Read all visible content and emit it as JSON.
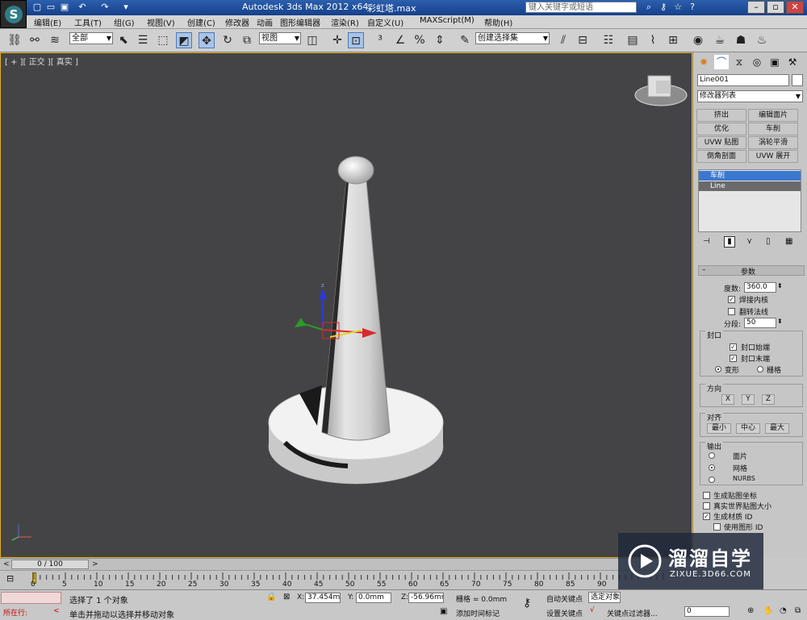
{
  "app": {
    "title": "Autodesk 3ds Max  2012 x64",
    "file_name": "彩虹塔.max",
    "search_placeholder": "键入关键字或短语"
  },
  "menu": [
    "编辑(E)",
    "工具(T)",
    "组(G)",
    "视图(V)",
    "创建(C)",
    "修改器",
    "动画",
    "图形编辑器",
    "渲染(R)",
    "自定义(U)",
    "MAXScript(M)",
    "帮助(H)"
  ],
  "toolbar": {
    "selection_filter": "全部",
    "reference_coord": "视图",
    "named_selection": "创建选择集"
  },
  "viewport": {
    "label": "[ + ][ 正交 ][ 真实 ]"
  },
  "command_panel": {
    "object_name": "Line001",
    "modifier_list": "修改器列表",
    "modifier_buttons": [
      "挤出",
      "编辑面片",
      "优化",
      "车削",
      "UVW 贴图",
      "涡轮平滑",
      "倒角剖面",
      "UVW 展开"
    ],
    "stack": [
      "车削",
      "Line"
    ],
    "params_title": "参数",
    "degrees_label": "度数:",
    "degrees_value": "360.0",
    "weld_core": "焊接内核",
    "flip_normals": "翻转法线",
    "segments_label": "分段:",
    "segments_value": "50",
    "capping_title": "封口",
    "cap_start": "封口始端",
    "cap_end": "封口末端",
    "morph": "变形",
    "grid": "栅格",
    "direction_title": "方向",
    "dir_x": "X",
    "dir_y": "Y",
    "dir_z": "Z",
    "align_title": "对齐",
    "align_min": "最小",
    "align_center": "中心",
    "align_max": "最大",
    "output_title": "输出",
    "out_patch": "面片",
    "out_mesh": "网格",
    "out_nurbs": "NURBS",
    "gen_map_coords": "生成贴图坐标",
    "real_world_map": "真实世界贴图大小",
    "gen_mat_ids": "生成材质 ID",
    "use_shape_ids": "使用图形 ID"
  },
  "timeline": {
    "frame": "0 / 100",
    "ticks": [
      "0",
      "5",
      "10",
      "15",
      "20",
      "25",
      "30",
      "35",
      "40",
      "45",
      "50",
      "55",
      "60",
      "65",
      "70",
      "75",
      "80",
      "85",
      "90"
    ]
  },
  "status": {
    "running_label": "所在行:",
    "selection_msg": "选择了 1 个对象",
    "prompt_msg": "单击并拖动以选择并移动对象",
    "x_label": "X:",
    "x_value": "37.454mm",
    "y_label": "Y:",
    "y_value": "0.0mm",
    "z_label": "Z:",
    "z_value": "-56.96mm",
    "grid_label": "栅格 = 0.0mm",
    "add_time_tag": "添加时间标记",
    "auto_key": "自动关键点",
    "set_key": "设置关键点",
    "selected_object": "选定对象",
    "key_filters": "关键点过滤器...",
    "frame_value": "0"
  },
  "watermark": {
    "brand": "溜溜自学",
    "url": "ZIXUE.3D66.COM"
  },
  "colors": {
    "viewport_bg": "#444446",
    "active_border": "#e6b022",
    "title_bar": "#1e4e9c",
    "stack_highlight": "#3a78d0"
  }
}
